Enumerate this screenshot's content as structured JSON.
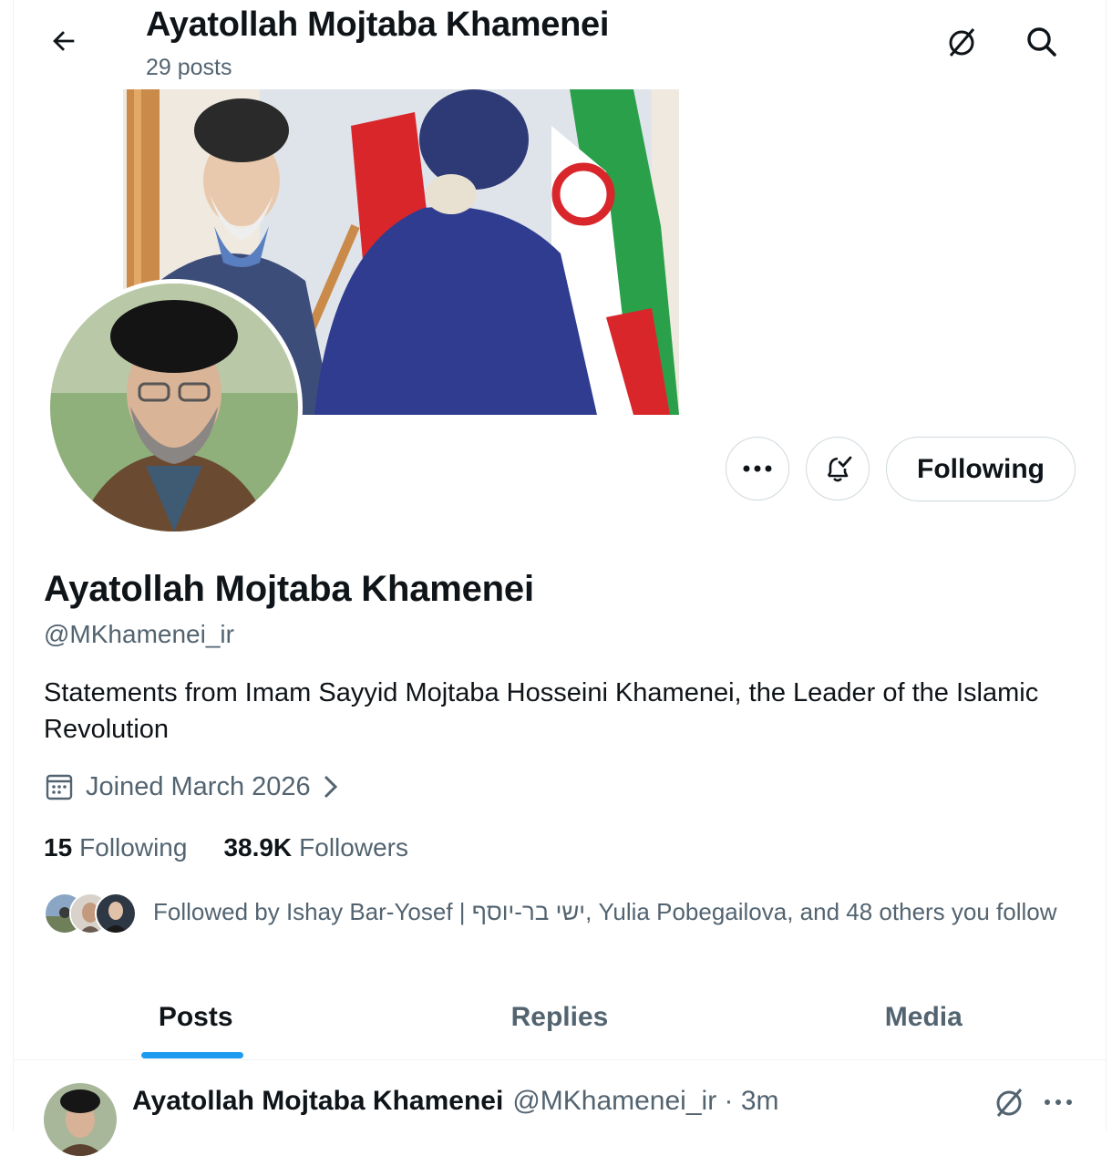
{
  "header": {
    "name": "Ayatollah Mojtaba Khamenei",
    "posts_count": "29 posts",
    "back_icon": "arrow-left-icon",
    "grok_icon": "grok-icon",
    "search_icon": "search-icon"
  },
  "profile": {
    "name": "Ayatollah Mojtaba Khamenei",
    "handle": "@MKhamenei_ir",
    "bio": "Statements from Imam Sayyid Mojtaba Hosseini Khamenei, the Leader of the Islamic Revolution",
    "joined": "Joined March 2026",
    "following_count": "15",
    "following_label": "Following",
    "followers_count": "38.9K",
    "followers_label": "Followers",
    "followed_by": "Followed by Ishay Bar-Yosef | ישי בר-יוסף, Yulia Pobegailova, and 48 others you follow"
  },
  "actions": {
    "following_button": "Following",
    "more_icon": "more-horizontal-icon",
    "notify_icon": "bell-check-icon"
  },
  "tabs": [
    {
      "label": "Posts",
      "active": true
    },
    {
      "label": "Replies",
      "active": false
    },
    {
      "label": "Media",
      "active": false
    }
  ],
  "post": {
    "author": "Ayatollah Mojtaba Khamenei",
    "meta": "@MKhamenei_ir · 3m"
  },
  "colors": {
    "accent": "#1d9bf0",
    "text_primary": "#0f1419",
    "text_secondary": "#536471",
    "border": "#cfd9de"
  }
}
